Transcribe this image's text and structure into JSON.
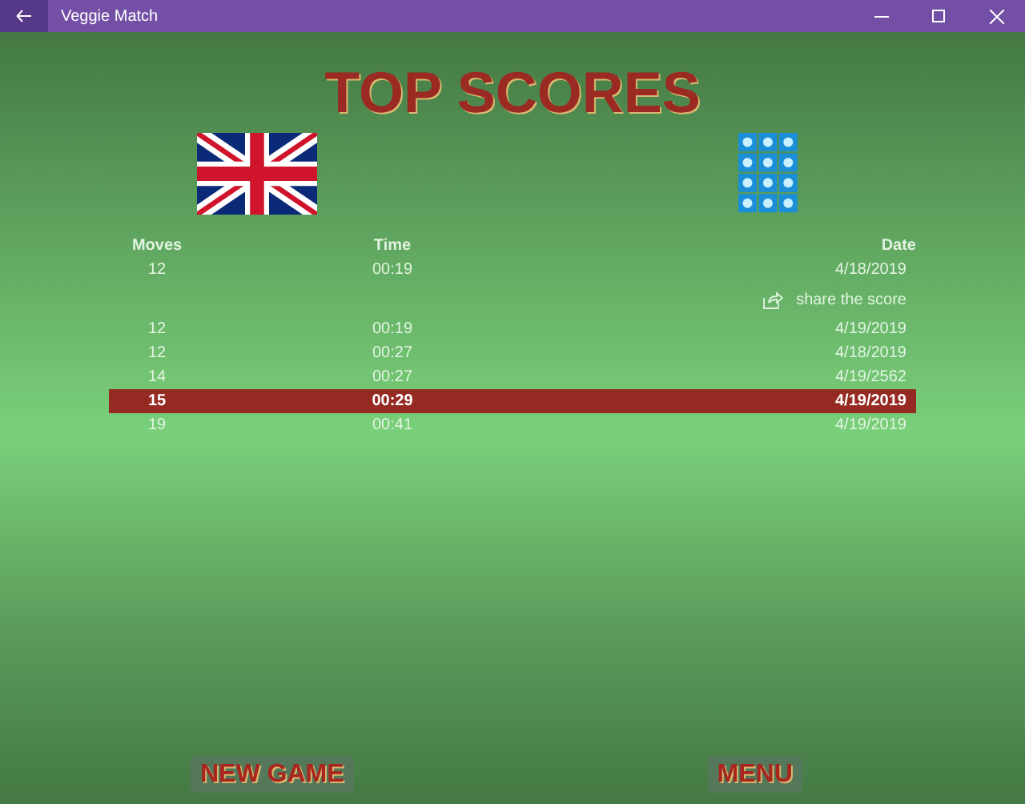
{
  "window": {
    "title": "Veggie Match"
  },
  "heading": "TOP SCORES",
  "table": {
    "columns": [
      "Moves",
      "Time",
      "Date"
    ],
    "rows": [
      {
        "kind": "score",
        "cells": [
          "12",
          "00:19",
          "4/18/2019"
        ],
        "selected": false
      },
      {
        "kind": "share",
        "label": "share the score"
      },
      {
        "kind": "score",
        "cells": [
          "12",
          "00:19",
          "4/19/2019"
        ],
        "selected": false
      },
      {
        "kind": "score",
        "cells": [
          "12",
          "00:27",
          "4/18/2019"
        ],
        "selected": false
      },
      {
        "kind": "score",
        "cells": [
          "14",
          "00:27",
          "4/19/2562"
        ],
        "selected": false
      },
      {
        "kind": "score",
        "cells": [
          "15",
          "00:29",
          "4/19/2019"
        ],
        "selected": true
      },
      {
        "kind": "score",
        "cells": [
          "19",
          "00:41",
          "4/19/2019"
        ],
        "selected": false
      }
    ]
  },
  "buttons": [
    "NEW GAME",
    "MENU"
  ]
}
